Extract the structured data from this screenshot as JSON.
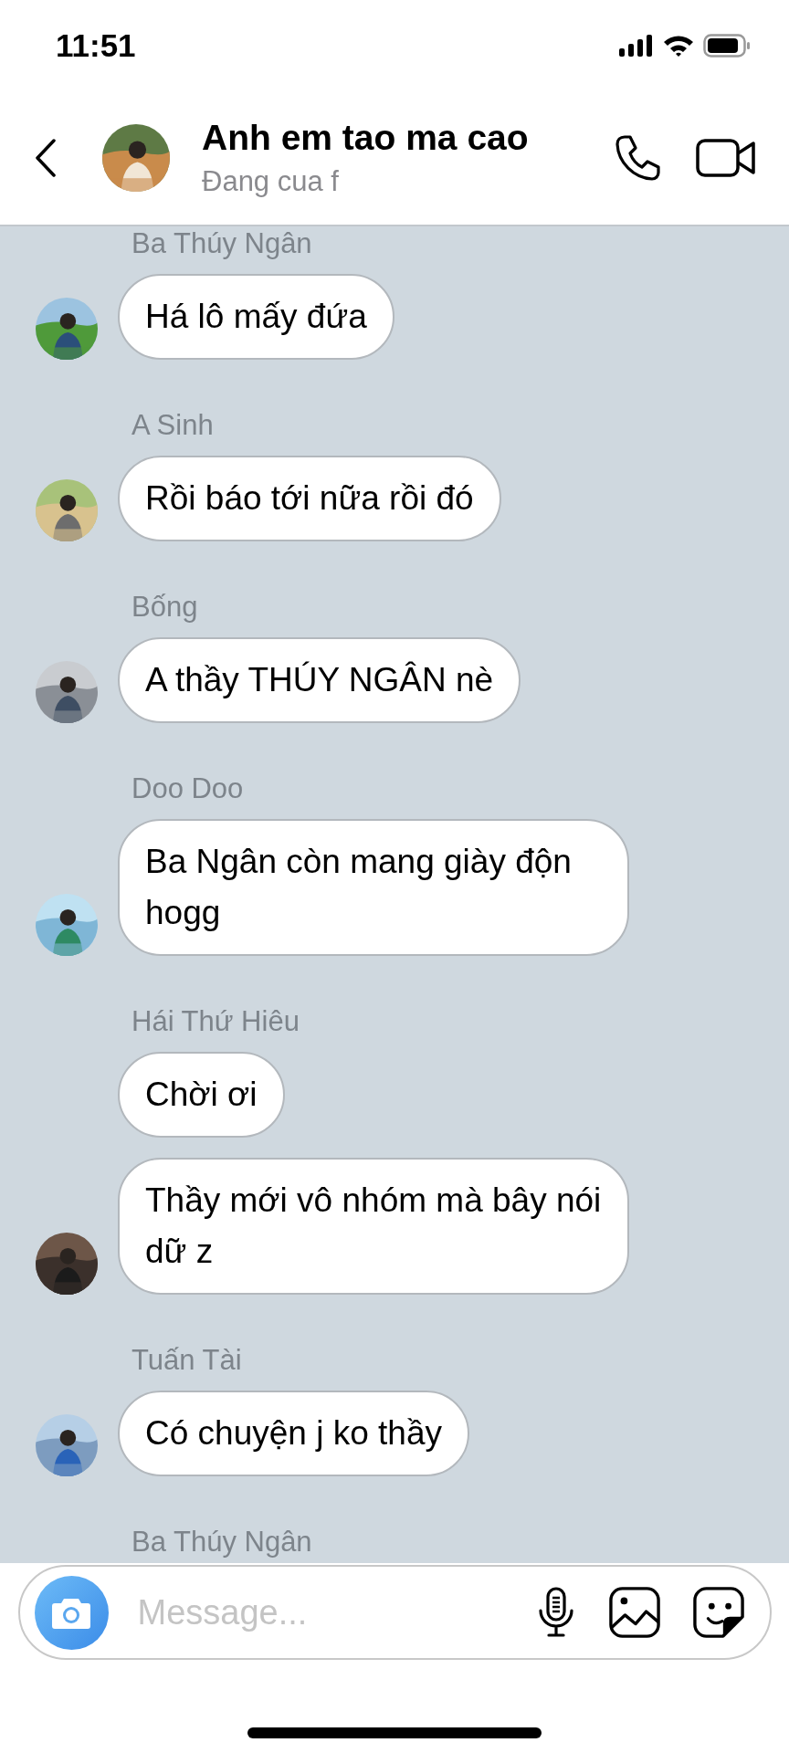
{
  "status_bar": {
    "time": "11:51"
  },
  "header": {
    "title": "Anh em tao ma cao",
    "subtitle": "Đang cua f"
  },
  "groups": [
    {
      "sender": "Ba Thúy Ngân",
      "messages": [
        "Há lô mấy đứa"
      ]
    },
    {
      "sender": "A Sinh",
      "messages": [
        "Rồi báo tới nữa rồi đó"
      ]
    },
    {
      "sender": "Bống",
      "messages": [
        "A thầy THÚY NGÂN nè"
      ]
    },
    {
      "sender": "Doo Doo",
      "messages": [
        "Ba Ngân còn mang giày độn hogg"
      ]
    },
    {
      "sender": "Hái Thứ Hiêu",
      "messages": [
        "Chời ơi",
        "Thầy mới vô nhóm mà bây nói dữ z"
      ]
    },
    {
      "sender": "Tuấn Tài",
      "messages": [
        "Có chuyện j ko thầy"
      ]
    },
    {
      "sender": "Ba Thúy Ngân"
    }
  ],
  "composer": {
    "placeholder": "Message..."
  }
}
